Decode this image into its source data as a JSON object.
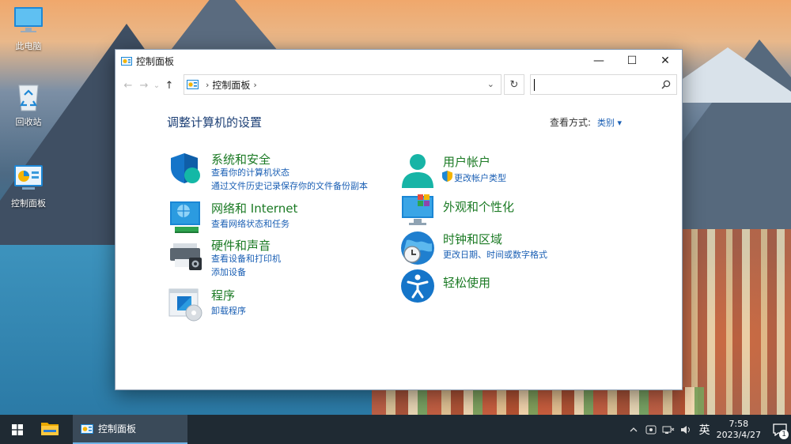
{
  "desktop": {
    "icons": [
      {
        "label": "此电脑"
      },
      {
        "label": "回收站"
      },
      {
        "label": "控制面板"
      }
    ]
  },
  "window": {
    "title": "控制面板",
    "controls": {
      "minimize": "—",
      "maximize": "☐",
      "close": "✕"
    },
    "nav": {
      "back": "←",
      "forward": "→",
      "recent": "⌄",
      "up": "↑"
    },
    "address": {
      "separator": "›",
      "path": "控制面板",
      "trail": "›",
      "dropdown": "⌄"
    },
    "refresh": "↻",
    "search": {
      "value": "",
      "placeholder": ""
    }
  },
  "page": {
    "heading": "调整计算机的设置",
    "view_by_label": "查看方式:",
    "view_by_value": "类别 ▾"
  },
  "categories_left": [
    {
      "title": "系统和安全",
      "icon": "shield-icon",
      "links": [
        "查看你的计算机状态",
        "通过文件历史记录保存你的文件备份副本"
      ]
    },
    {
      "title": "网络和 Internet",
      "icon": "network-icon",
      "links": [
        "查看网络状态和任务"
      ]
    },
    {
      "title": "硬件和声音",
      "icon": "printer-icon",
      "links": [
        "查看设备和打印机",
        "添加设备"
      ]
    },
    {
      "title": "程序",
      "icon": "programs-icon",
      "links": [
        "卸载程序"
      ]
    }
  ],
  "categories_right": [
    {
      "title": "用户帐户",
      "icon": "user-icon",
      "links": [
        "更改帐户类型"
      ]
    },
    {
      "title": "外观和个性化",
      "icon": "monitor-icon",
      "links": []
    },
    {
      "title": "时钟和区域",
      "icon": "clock-globe-icon",
      "links": [
        "更改日期、时间或数字格式"
      ]
    },
    {
      "title": "轻松使用",
      "icon": "accessibility-icon",
      "links": []
    }
  ],
  "taskbar": {
    "app_label": "控制面板",
    "lang": "英",
    "time": "7:58",
    "date": "2023/4/27",
    "notification_count": "1"
  },
  "colors": {
    "category_title": "#1b7a24",
    "link": "#1a5fb4",
    "heading": "#1c3f75",
    "taskbar": "#1f2a33"
  }
}
